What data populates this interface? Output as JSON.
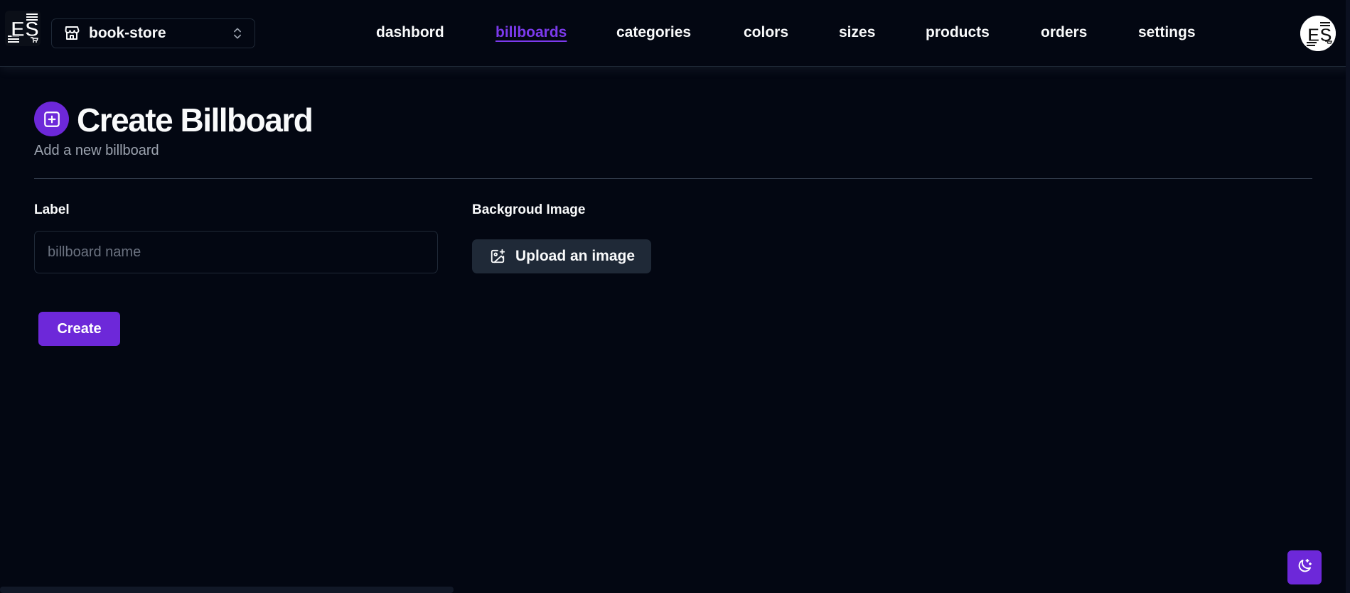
{
  "brand": {
    "logo_icon": "es-logo-icon",
    "accent": "#7c3aed",
    "background": "#030712"
  },
  "store_switcher": {
    "icon": "store-icon",
    "store_name": "book-store",
    "chevron_icon": "chevrons-up-down-icon"
  },
  "nav": {
    "items": [
      {
        "label": "dashbord",
        "active": false
      },
      {
        "label": "billboards",
        "active": true
      },
      {
        "label": "categories",
        "active": false
      },
      {
        "label": "colors",
        "active": false
      },
      {
        "label": "sizes",
        "active": false
      },
      {
        "label": "products",
        "active": false
      },
      {
        "label": "orders",
        "active": false
      },
      {
        "label": "settings",
        "active": false
      }
    ]
  },
  "user": {
    "avatar_icon": "user-avatar-icon"
  },
  "heading": {
    "icon": "plus-square-icon",
    "title": "Create Billboard",
    "subtitle": "Add a new billboard"
  },
  "form": {
    "label_field": {
      "label": "Label",
      "value": "",
      "placeholder": "billboard name"
    },
    "background_image": {
      "label": "Backgroud Image",
      "upload_icon": "image-plus-icon",
      "upload_label": "Upload an image"
    },
    "submit_label": "Create"
  },
  "theme_toggle": {
    "icon": "moon-stars-icon"
  }
}
